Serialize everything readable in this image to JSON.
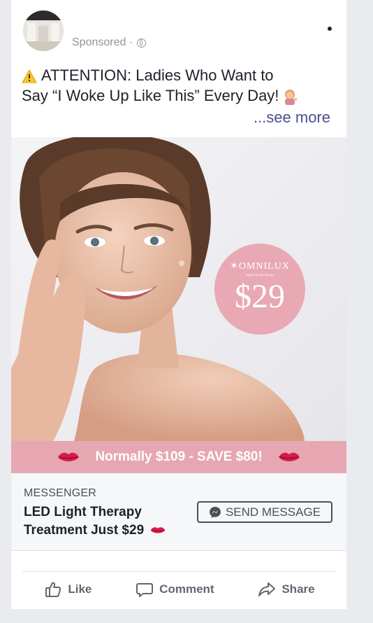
{
  "post": {
    "sponsored_label": "Sponsored ·",
    "text_line1": "ATTENTION: Ladies Who Want to",
    "text_line2": "Say “I Woke Up Like This” Every Day!",
    "see_more": "...see more"
  },
  "ad_image": {
    "brand": "OMNILUX",
    "brand_tagline": "leaders in light therapy",
    "price": "$29",
    "promo": "Normally $109 - SAVE $80!",
    "badge_color": "#e8a9b4"
  },
  "cta": {
    "source_label": "MESSENGER",
    "headline": "LED Light Therapy Treatment Just $29",
    "button_label": "SEND MESSAGE"
  },
  "actions": {
    "like": "Like",
    "comment": "Comment",
    "share": "Share"
  },
  "icons": [
    "globe-icon",
    "more-icon",
    "warning-icon",
    "woman-tipping-hand-icon",
    "lips-icon",
    "messenger-icon",
    "like-icon",
    "comment-icon",
    "share-icon"
  ]
}
